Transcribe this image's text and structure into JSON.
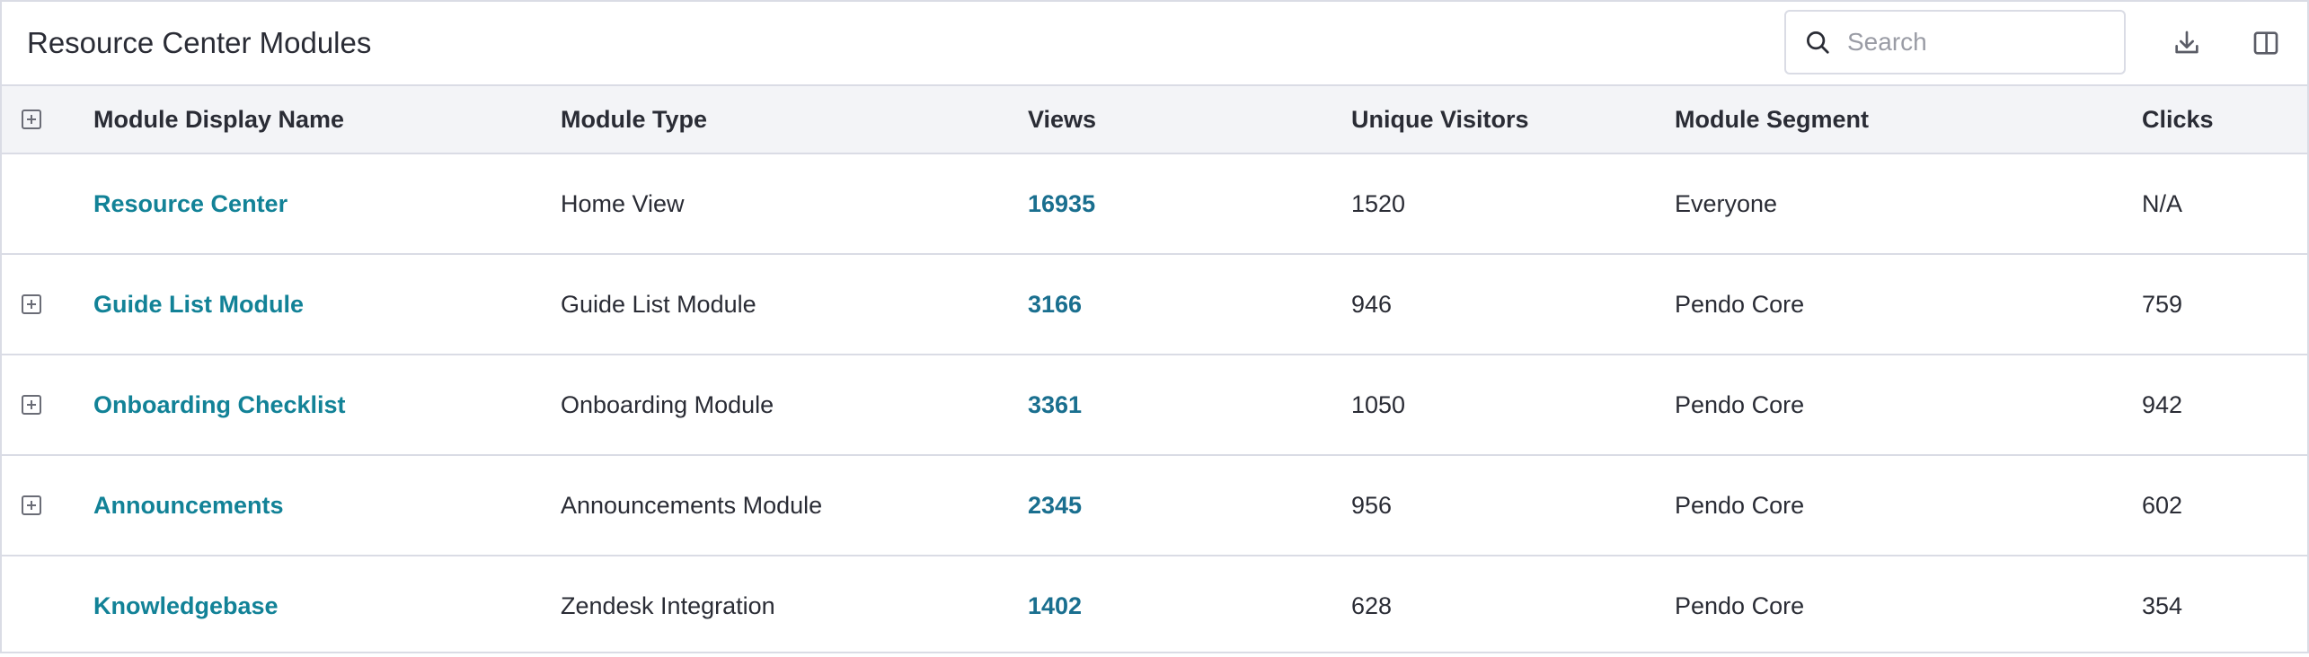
{
  "header": {
    "title": "Resource Center Modules",
    "search_placeholder": "Search",
    "search_value": "",
    "search_icon": "search-icon",
    "download_icon": "download-icon",
    "columns_icon": "columns-icon"
  },
  "table": {
    "columns": [
      "Module Display Name",
      "Module Type",
      "Views",
      "Unique Visitors",
      "Module Segment",
      "Clicks"
    ],
    "rows": [
      {
        "expandable": false,
        "name": "Resource Center",
        "type": "Home View",
        "views": "16935",
        "visitors": "1520",
        "segment": "Everyone",
        "clicks": "N/A"
      },
      {
        "expandable": true,
        "name": "Guide List Module",
        "type": "Guide List Module",
        "views": "3166",
        "visitors": "946",
        "segment": "Pendo Core",
        "clicks": "759"
      },
      {
        "expandable": true,
        "name": "Onboarding Checklist",
        "type": "Onboarding Module",
        "views": "3361",
        "visitors": "1050",
        "segment": "Pendo Core",
        "clicks": "942"
      },
      {
        "expandable": true,
        "name": "Announcements",
        "type": "Announcements Module",
        "views": "2345",
        "visitors": "956",
        "segment": "Pendo Core",
        "clicks": "602"
      },
      {
        "expandable": false,
        "name": "Knowledgebase",
        "type": "Zendesk Integration",
        "views": "1402",
        "visitors": "628",
        "segment": "Pendo Core",
        "clicks": "354"
      }
    ]
  },
  "colors": {
    "link": "#128297",
    "views": "#1a6f8f",
    "border": "#dadce5",
    "header_bg": "#f3f4f7"
  }
}
